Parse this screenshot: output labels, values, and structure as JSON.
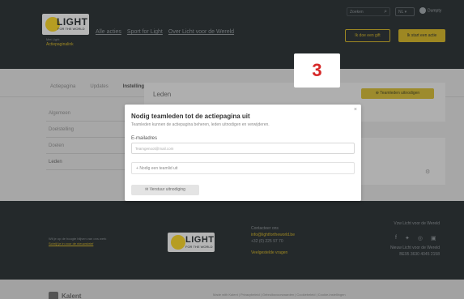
{
  "header": {
    "logo_main": "LIGHT",
    "logo_sub": "FOR THE WORLD",
    "tagline": "Met Light",
    "actiepagina_link": "Actiepaginalink",
    "nav": [
      "Alle acties",
      "Sport for Light",
      "Over Licht voor de Wereld"
    ],
    "search_placeholder": "Zoeken",
    "language": "NL",
    "user": "Dumpty",
    "gift_button": "Ik doe een gift",
    "actie_button": "Ik start een actie"
  },
  "tabs": [
    "Actiepagina",
    "Updates",
    "Instellingen"
  ],
  "sidebar": {
    "items": [
      "Algemeen",
      "Doelstelling",
      "Doelen",
      "Leden"
    ]
  },
  "leden_card": {
    "title": "Leden",
    "button": "Teamleden uitnodigen"
  },
  "modal": {
    "title": "Nodig teamleden tot de actiepagina uit",
    "description": "Teamleden kunnen de actiepagina beheren, leden uitnodigen en verwijderen.",
    "email_label": "E-mailadres",
    "email_placeholder": "Teamgenoot@mail.com",
    "add_label": "Nodig een teamlid uit",
    "send_label": "Verstuur uitnodiging",
    "close_glyph": "×"
  },
  "step_badge": "3",
  "footer": {
    "left_line1": "Wil je op de hoogte blijven van ons werk",
    "left_line2": "Schrijf je in voor de nieuwsbrief",
    "logo_main": "LIGHT",
    "logo_sub": "FOR THE WORLD",
    "contact_title": "Contacteer ons",
    "contact_email": "info@lightfortheworld.be",
    "contact_phone": "+32 (0) 225 97 70",
    "faq": "Veelgestelde vragen",
    "right_line1": "Vzw Licht voor de Wereld",
    "right_line2": "Nieuw Licht voor de Wereld",
    "right_line3": "BE95 3630 4045 2158",
    "legal": "Made with Kalent | Privacybeleid | Gebruiksvoorwaarden | Cookiebeleid | Cookie-instellingen"
  },
  "bottombar": {
    "brand": "Kalent"
  }
}
